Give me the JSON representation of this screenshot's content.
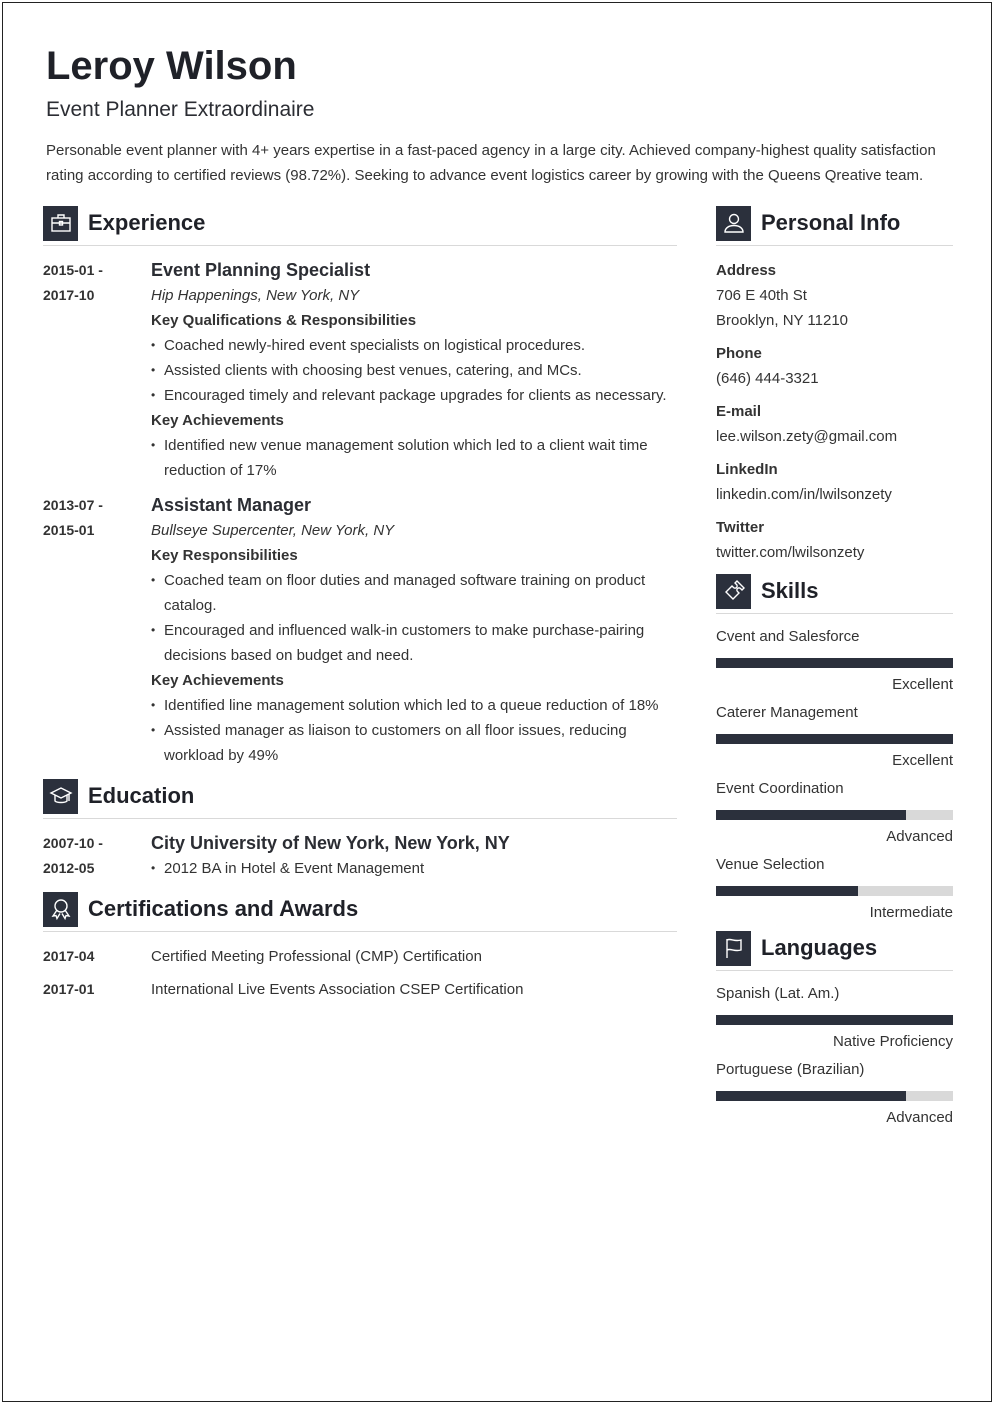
{
  "header": {
    "name": "Leroy Wilson",
    "title": "Event Planner Extraordinaire",
    "summary": "Personable event planner with 4+ years expertise in a fast-paced agency in a large city. Achieved company-highest quality satisfaction rating according to certified reviews (98.72%). Seeking to advance event logistics career by growing with the Queens Qreative team."
  },
  "experience": {
    "heading": "Experience",
    "icon": "briefcase-icon",
    "jobs": [
      {
        "date_start": "2015-01 -",
        "date_end": "2017-10",
        "title": "Event Planning Specialist",
        "company": "Hip Happenings, New York, NY",
        "sections": [
          {
            "heading": "Key Qualifications & Responsibilities",
            "bullets": [
              "Coached newly-hired event specialists on logistical procedures.",
              "Assisted clients with choosing best venues, catering, and MCs.",
              "Encouraged timely and relevant package upgrades for clients as necessary."
            ]
          },
          {
            "heading": "Key Achievements",
            "bullets": [
              "Identified new venue management solution which led to a client wait time reduction of 17%"
            ]
          }
        ]
      },
      {
        "date_start": "2013-07 -",
        "date_end": "2015-01",
        "title": "Assistant Manager",
        "company": "Bullseye Supercenter, New York, NY",
        "sections": [
          {
            "heading": "Key Responsibilities",
            "bullets": [
              "Coached team on floor duties and managed software training on product catalog.",
              "Encouraged and influenced walk-in customers to make purchase-pairing decisions based on budget and need."
            ]
          },
          {
            "heading": "Key Achievements",
            "bullets": [
              "Identified line management solution which led to a queue reduction of 18%",
              "Assisted manager as liaison to customers on all floor issues, reducing workload by 49%"
            ]
          }
        ]
      }
    ]
  },
  "education": {
    "heading": "Education",
    "icon": "graduation-cap-icon",
    "items": [
      {
        "date_start": "2007-10 -",
        "date_end": "2012-05",
        "school": "City University of New York, New York, NY",
        "bullets": [
          "2012 BA in Hotel & Event Management"
        ]
      }
    ]
  },
  "certifications": {
    "heading": "Certifications and Awards",
    "icon": "award-ribbon-icon",
    "items": [
      {
        "date": "2017-04",
        "name": "Certified Meeting Professional (CMP) Certification"
      },
      {
        "date": "2017-01",
        "name": "International Live Events Association CSEP Certification"
      }
    ]
  },
  "personal_info": {
    "heading": "Personal Info",
    "icon": "user-icon",
    "address_label": "Address",
    "address_line1": "706 E 40th St",
    "address_line2": "Brooklyn, NY 11210",
    "phone_label": "Phone",
    "phone": "(646) 444-3321",
    "email_label": "E-mail",
    "email": "lee.wilson.zety@gmail.com",
    "linkedin_label": "LinkedIn",
    "linkedin": "linkedin.com/in/lwilsonzety",
    "twitter_label": "Twitter",
    "twitter": "twitter.com/lwilsonzety"
  },
  "skills": {
    "heading": "Skills",
    "icon": "puzzle-icon",
    "items": [
      {
        "name": "Cvent and Salesforce",
        "level": "Excellent",
        "proficiency": 1.0
      },
      {
        "name": "Caterer Management",
        "level": "Excellent",
        "proficiency": 1.0
      },
      {
        "name": "Event Coordination",
        "level": "Advanced",
        "proficiency": 0.8
      },
      {
        "name": "Venue Selection",
        "level": "Intermediate",
        "proficiency": 0.6
      }
    ]
  },
  "languages": {
    "heading": "Languages",
    "icon": "flag-icon",
    "items": [
      {
        "name": "Spanish (Lat. Am.)",
        "level": "Native Proficiency",
        "proficiency": 1.0
      },
      {
        "name": "Portuguese (Brazilian)",
        "level": "Advanced",
        "proficiency": 0.8
      }
    ]
  },
  "colors": {
    "accent": "#2b303c",
    "bar_track": "#d9d9d9",
    "text": "#333333"
  }
}
